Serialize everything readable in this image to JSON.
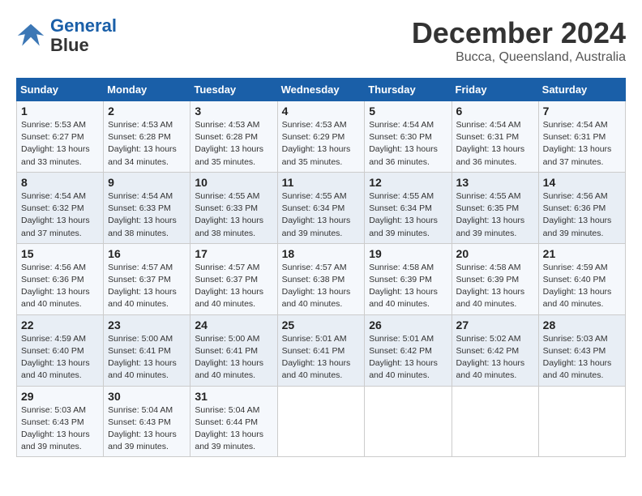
{
  "logo": {
    "line1": "General",
    "line2": "Blue"
  },
  "title": "December 2024",
  "location": "Bucca, Queensland, Australia",
  "days_of_week": [
    "Sunday",
    "Monday",
    "Tuesday",
    "Wednesday",
    "Thursday",
    "Friday",
    "Saturday"
  ],
  "weeks": [
    [
      {
        "day": "1",
        "sunrise": "5:53 AM",
        "sunset": "6:27 PM",
        "daylight": "13 hours and 33 minutes."
      },
      {
        "day": "2",
        "sunrise": "4:53 AM",
        "sunset": "6:28 PM",
        "daylight": "13 hours and 34 minutes."
      },
      {
        "day": "3",
        "sunrise": "4:53 AM",
        "sunset": "6:28 PM",
        "daylight": "13 hours and 35 minutes."
      },
      {
        "day": "4",
        "sunrise": "4:53 AM",
        "sunset": "6:29 PM",
        "daylight": "13 hours and 35 minutes."
      },
      {
        "day": "5",
        "sunrise": "4:54 AM",
        "sunset": "6:30 PM",
        "daylight": "13 hours and 36 minutes."
      },
      {
        "day": "6",
        "sunrise": "4:54 AM",
        "sunset": "6:31 PM",
        "daylight": "13 hours and 36 minutes."
      },
      {
        "day": "7",
        "sunrise": "4:54 AM",
        "sunset": "6:31 PM",
        "daylight": "13 hours and 37 minutes."
      }
    ],
    [
      {
        "day": "8",
        "sunrise": "4:54 AM",
        "sunset": "6:32 PM",
        "daylight": "13 hours and 37 minutes."
      },
      {
        "day": "9",
        "sunrise": "4:54 AM",
        "sunset": "6:33 PM",
        "daylight": "13 hours and 38 minutes."
      },
      {
        "day": "10",
        "sunrise": "4:55 AM",
        "sunset": "6:33 PM",
        "daylight": "13 hours and 38 minutes."
      },
      {
        "day": "11",
        "sunrise": "4:55 AM",
        "sunset": "6:34 PM",
        "daylight": "13 hours and 39 minutes."
      },
      {
        "day": "12",
        "sunrise": "4:55 AM",
        "sunset": "6:34 PM",
        "daylight": "13 hours and 39 minutes."
      },
      {
        "day": "13",
        "sunrise": "4:55 AM",
        "sunset": "6:35 PM",
        "daylight": "13 hours and 39 minutes."
      },
      {
        "day": "14",
        "sunrise": "4:56 AM",
        "sunset": "6:36 PM",
        "daylight": "13 hours and 39 minutes."
      }
    ],
    [
      {
        "day": "15",
        "sunrise": "4:56 AM",
        "sunset": "6:36 PM",
        "daylight": "13 hours and 40 minutes."
      },
      {
        "day": "16",
        "sunrise": "4:57 AM",
        "sunset": "6:37 PM",
        "daylight": "13 hours and 40 minutes."
      },
      {
        "day": "17",
        "sunrise": "4:57 AM",
        "sunset": "6:37 PM",
        "daylight": "13 hours and 40 minutes."
      },
      {
        "day": "18",
        "sunrise": "4:57 AM",
        "sunset": "6:38 PM",
        "daylight": "13 hours and 40 minutes."
      },
      {
        "day": "19",
        "sunrise": "4:58 AM",
        "sunset": "6:39 PM",
        "daylight": "13 hours and 40 minutes."
      },
      {
        "day": "20",
        "sunrise": "4:58 AM",
        "sunset": "6:39 PM",
        "daylight": "13 hours and 40 minutes."
      },
      {
        "day": "21",
        "sunrise": "4:59 AM",
        "sunset": "6:40 PM",
        "daylight": "13 hours and 40 minutes."
      }
    ],
    [
      {
        "day": "22",
        "sunrise": "4:59 AM",
        "sunset": "6:40 PM",
        "daylight": "13 hours and 40 minutes."
      },
      {
        "day": "23",
        "sunrise": "5:00 AM",
        "sunset": "6:41 PM",
        "daylight": "13 hours and 40 minutes."
      },
      {
        "day": "24",
        "sunrise": "5:00 AM",
        "sunset": "6:41 PM",
        "daylight": "13 hours and 40 minutes."
      },
      {
        "day": "25",
        "sunrise": "5:01 AM",
        "sunset": "6:41 PM",
        "daylight": "13 hours and 40 minutes."
      },
      {
        "day": "26",
        "sunrise": "5:01 AM",
        "sunset": "6:42 PM",
        "daylight": "13 hours and 40 minutes."
      },
      {
        "day": "27",
        "sunrise": "5:02 AM",
        "sunset": "6:42 PM",
        "daylight": "13 hours and 40 minutes."
      },
      {
        "day": "28",
        "sunrise": "5:03 AM",
        "sunset": "6:43 PM",
        "daylight": "13 hours and 40 minutes."
      }
    ],
    [
      {
        "day": "29",
        "sunrise": "5:03 AM",
        "sunset": "6:43 PM",
        "daylight": "13 hours and 39 minutes."
      },
      {
        "day": "30",
        "sunrise": "5:04 AM",
        "sunset": "6:43 PM",
        "daylight": "13 hours and 39 minutes."
      },
      {
        "day": "31",
        "sunrise": "5:04 AM",
        "sunset": "6:44 PM",
        "daylight": "13 hours and 39 minutes."
      },
      null,
      null,
      null,
      null
    ]
  ]
}
